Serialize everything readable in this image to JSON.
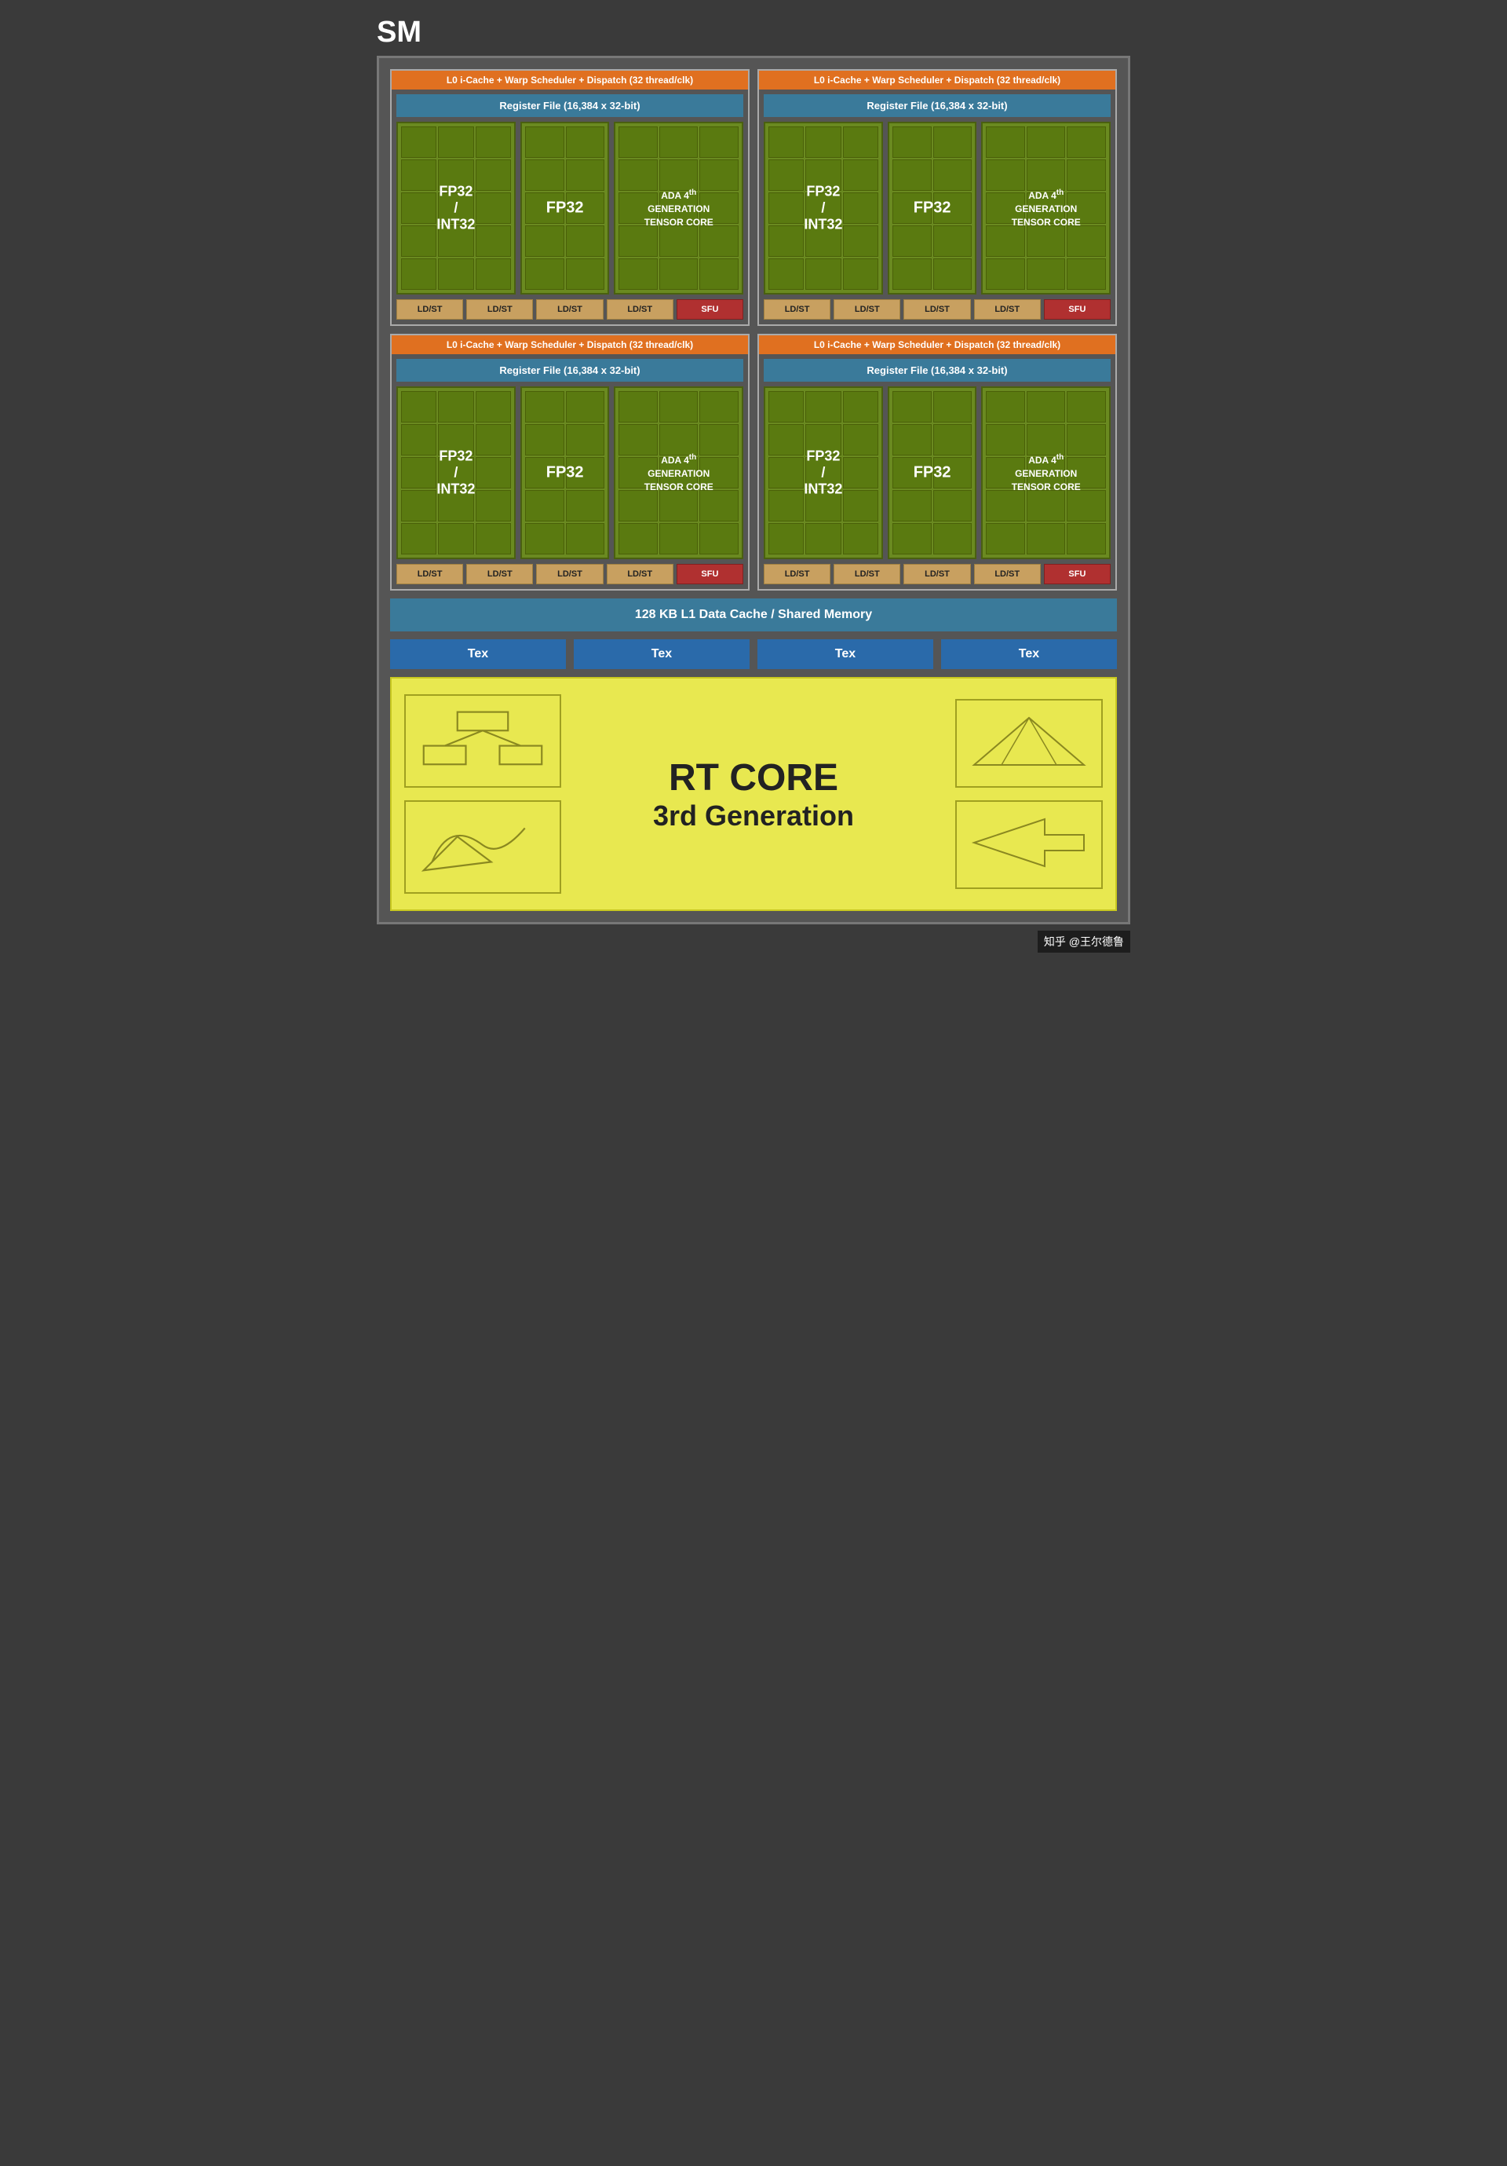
{
  "title": "SM",
  "warp_scheduler": "L0 i-Cache + Warp Scheduler + Dispatch (32 thread/clk)",
  "register_file": "Register File (16,384 x 32-bit)",
  "fp32_int32_label": "FP32\n/\nINT32",
  "fp32_label": "FP32",
  "tensor_label": "ADA 4th\nGENERATION\nTENSOR CORE",
  "ldst_labels": [
    "LD/ST",
    "LD/ST",
    "LD/ST",
    "LD/ST"
  ],
  "sfu_label": "SFU",
  "l1_cache": "128 KB L1 Data Cache / Shared Memory",
  "tex_labels": [
    "Tex",
    "Tex",
    "Tex",
    "Tex"
  ],
  "rt_core_title": "RT CORE",
  "rt_core_subtitle": "3rd Generation",
  "watermark": "知乎 @王尔德鲁"
}
